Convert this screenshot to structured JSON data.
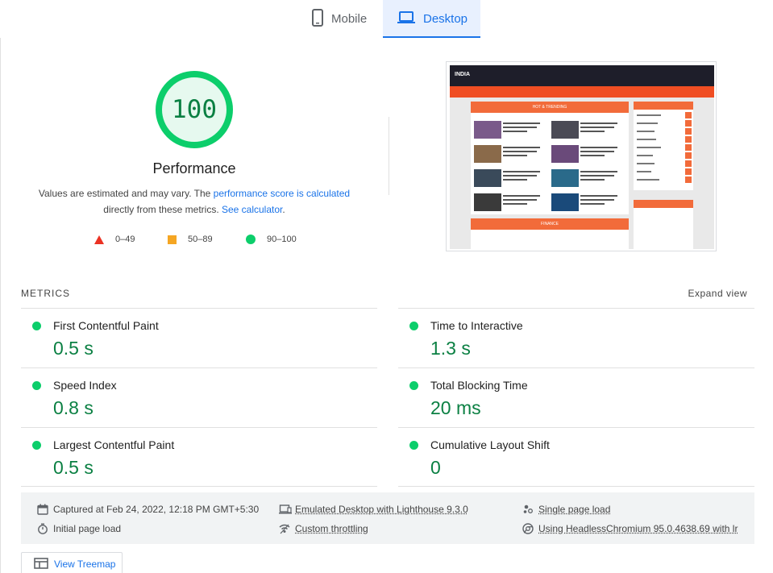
{
  "tabs": [
    {
      "label": "Mobile",
      "icon": "smartphone-icon",
      "active": false
    },
    {
      "label": "Desktop",
      "icon": "laptop-icon",
      "active": true
    }
  ],
  "score": {
    "value": "100",
    "title": "Performance",
    "desc_text": "Values are estimated and may vary. The ",
    "desc_link1": "performance score is calculated",
    "desc_text2": "directly from these metrics. ",
    "desc_link2": "See calculator",
    "desc_end": ".",
    "ring_color": "#0cce6b"
  },
  "legend": [
    {
      "range": "0–49",
      "shape": "triangle",
      "color": "#eb3223"
    },
    {
      "range": "50–89",
      "shape": "square",
      "color": "#f5a623"
    },
    {
      "range": "90–100",
      "shape": "circle",
      "color": "#0cce6b"
    }
  ],
  "thumbnail": {
    "logo_text": "INDIA",
    "section1": "HOT & TRENDING",
    "section2": "FINANCE"
  },
  "metrics": {
    "title": "METRICS",
    "expand_label": "Expand view",
    "items": [
      {
        "name": "First Contentful Paint",
        "value": "0.5 s"
      },
      {
        "name": "Time to Interactive",
        "value": "1.3 s"
      },
      {
        "name": "Speed Index",
        "value": "0.8 s"
      },
      {
        "name": "Total Blocking Time",
        "value": "20 ms"
      },
      {
        "name": "Largest Contentful Paint",
        "value": "0.5 s"
      },
      {
        "name": "Cumulative Layout Shift",
        "value": "0"
      }
    ]
  },
  "info": {
    "captured": "Captured at Feb 24, 2022, 12:18 PM GMT+5:30",
    "emulated": "Emulated Desktop with Lighthouse 9.3.0",
    "single": "Single page load",
    "initial": "Initial page load",
    "throttling": "Custom throttling",
    "using": "Using HeadlessChromium 95.0.4638.69 with lr"
  },
  "treemap_label": "View Treemap"
}
